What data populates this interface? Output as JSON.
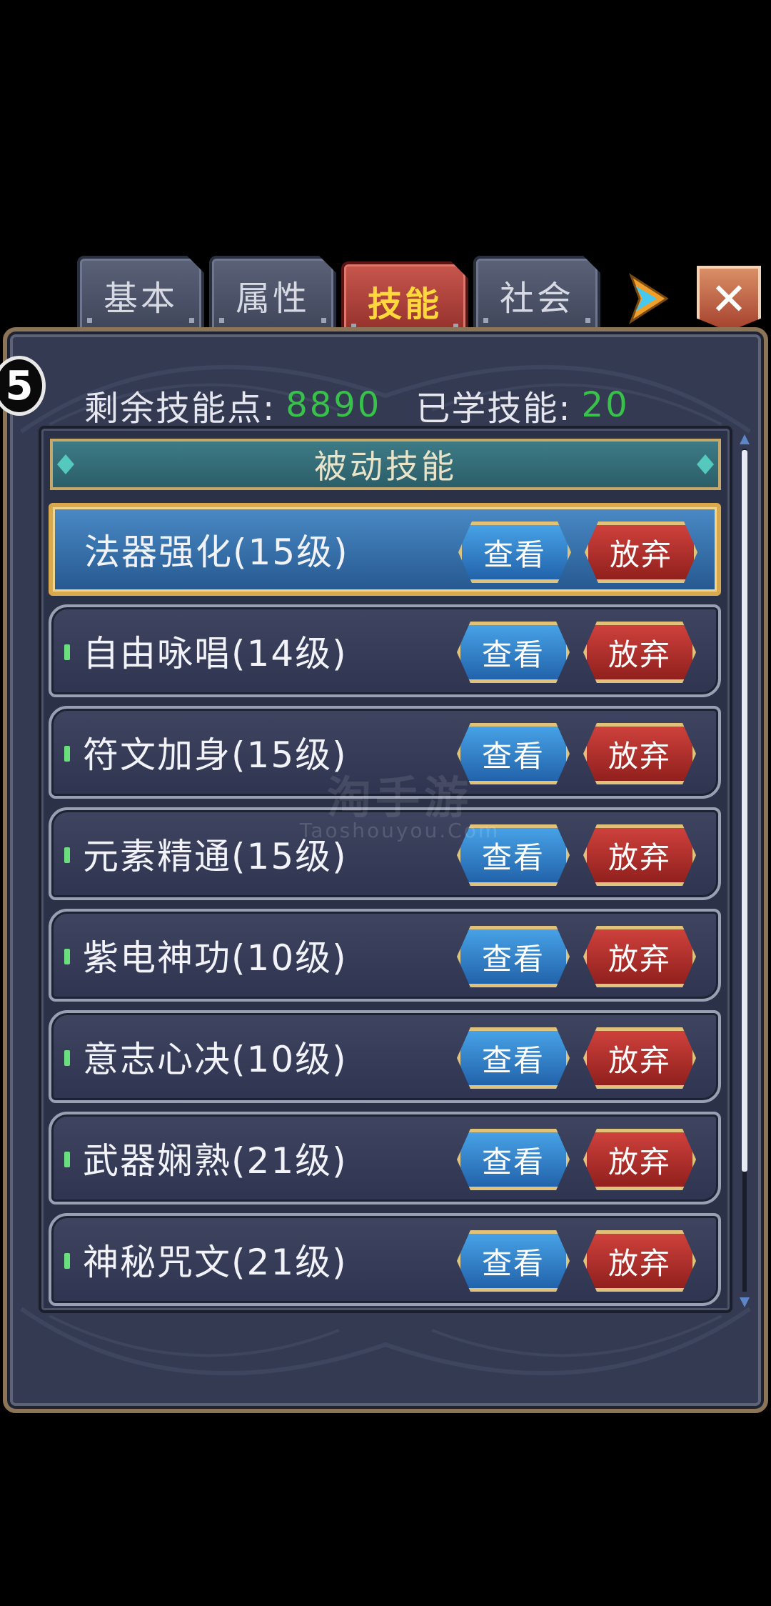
{
  "tabs": [
    {
      "label": "基本",
      "active": false
    },
    {
      "label": "属性",
      "active": false
    },
    {
      "label": "技能",
      "active": true
    },
    {
      "label": "社会",
      "active": false
    }
  ],
  "close_label": "✕",
  "badge_text": "5",
  "stats": {
    "remaining_points_label": "剩余技能点:",
    "remaining_points_value": "8890",
    "learned_skills_label": "已学技能:",
    "learned_skills_value": "20"
  },
  "section_header": "被动技能",
  "skills": [
    {
      "name": "法器强化(15级)",
      "selected": true
    },
    {
      "name": "自由咏唱(14级)",
      "selected": false
    },
    {
      "name": "符文加身(15级)",
      "selected": false
    },
    {
      "name": "元素精通(15级)",
      "selected": false
    },
    {
      "name": "紫电神功(10级)",
      "selected": false
    },
    {
      "name": "意志心决(10级)",
      "selected": false
    },
    {
      "name": "武器娴熟(21级)",
      "selected": false
    },
    {
      "name": "神秘咒文(21级)",
      "selected": false
    }
  ],
  "buttons": {
    "view_label": "查看",
    "abandon_label": "放弃"
  },
  "watermark": {
    "main": "淘手游",
    "sub": "Taoshouyou.Com"
  },
  "colors": {
    "accent_green": "#38c24a",
    "active_tab_text": "#ffd93b",
    "view_button": "#1f5fa7",
    "abandon_button": "#8d1e1b"
  }
}
